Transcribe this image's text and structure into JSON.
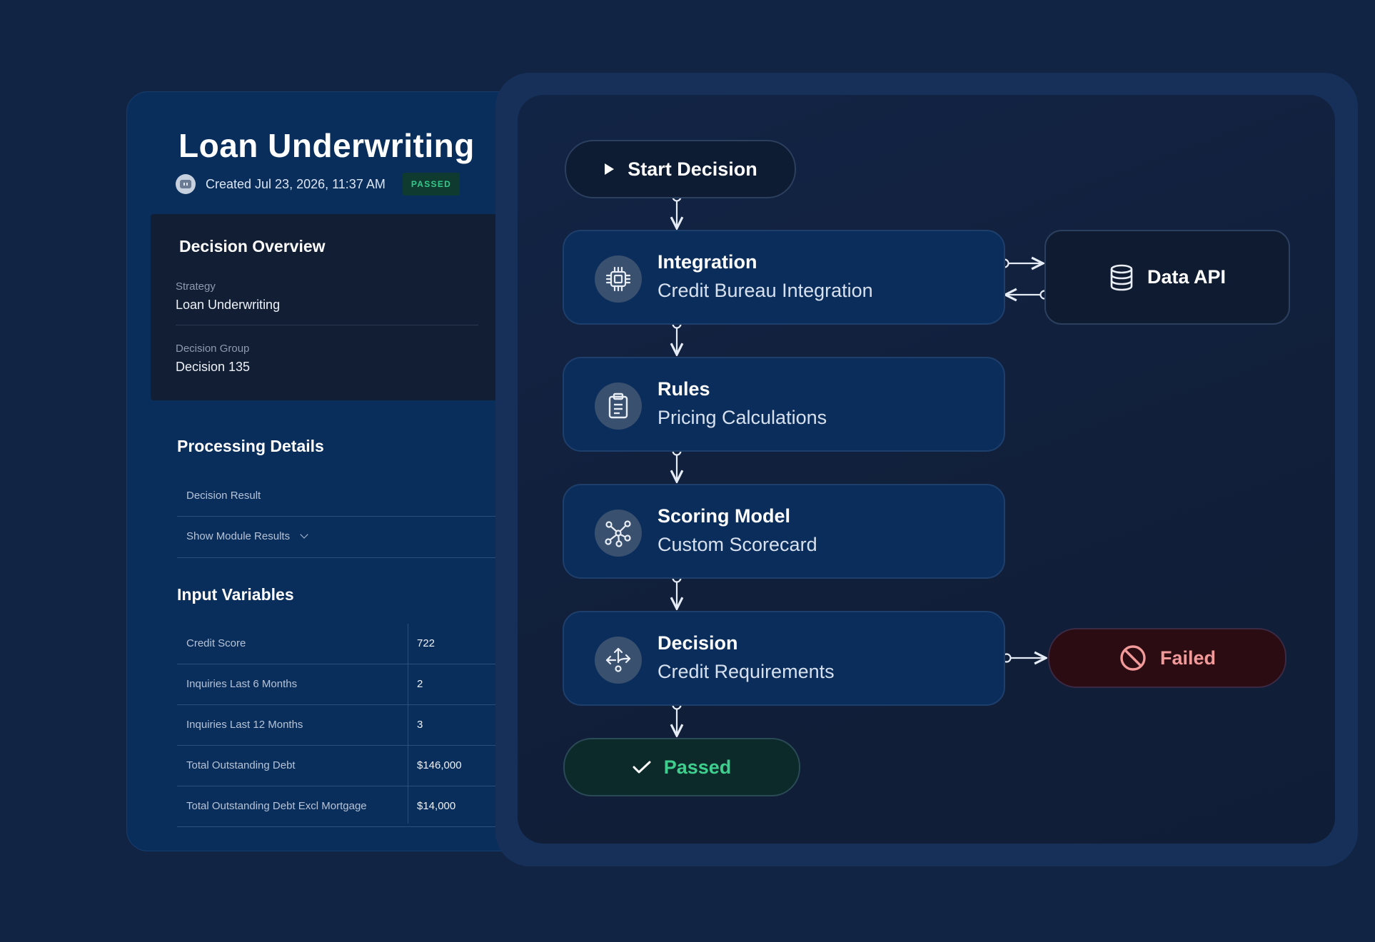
{
  "details": {
    "title": "Loan Underwriting",
    "created": "Created Jul 23, 2026, 11:37 AM",
    "status_badge": "PASSED",
    "overview": {
      "title": "Decision Overview",
      "strategy_label": "Strategy",
      "strategy_value": "Loan Underwriting",
      "group_label": "Decision Group",
      "group_value": "Decision 135"
    },
    "processing": {
      "title": "Processing Details",
      "decision_result": "Decision Result",
      "show_module_results": "Show Module Results"
    },
    "inputs": {
      "title": "Input Variables",
      "rows": [
        {
          "label": "Credit Score",
          "value": "722"
        },
        {
          "label": "Inquiries Last 6 Months",
          "value": "2"
        },
        {
          "label": "Inquiries Last 12 Months",
          "value": "3"
        },
        {
          "label": "Total Outstanding Debt",
          "value": "$146,000"
        },
        {
          "label": "Total Outstanding Debt Excl Mortgage",
          "value": "$14,000"
        }
      ]
    }
  },
  "flow": {
    "start": "Start Decision",
    "nodes": [
      {
        "title": "Integration",
        "subtitle": "Credit Bureau Integration",
        "icon": "chip-icon"
      },
      {
        "title": "Rules",
        "subtitle": "Pricing Calculations",
        "icon": "clipboard-icon"
      },
      {
        "title": "Scoring Model",
        "subtitle": "Custom Scorecard",
        "icon": "network-icon"
      },
      {
        "title": "Decision",
        "subtitle": "Credit Requirements",
        "icon": "split-arrows-icon"
      }
    ],
    "data_api": "Data API",
    "failed": "Failed",
    "passed": "Passed"
  },
  "colors": {
    "background": "#112443",
    "node": "#0b2d5b",
    "passed": "#3ecf8e",
    "failed": "#f29a9a"
  }
}
